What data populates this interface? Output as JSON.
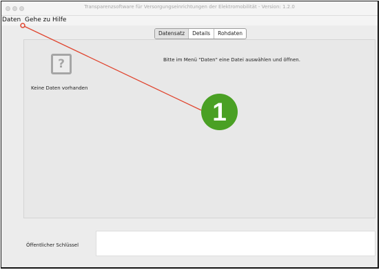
{
  "window": {
    "title": "Transparenzsoftware für Versorgungseinrichtungen der Elektromobilität - Version: 1.2.0"
  },
  "menubar": {
    "items": [
      "Daten",
      "Gehe zu",
      "Hilfe"
    ]
  },
  "tabs": {
    "items": [
      "Datensatz",
      "Details",
      "Rohdaten"
    ],
    "selected": "Datensatz"
  },
  "content": {
    "placeholder_icon_glyph": "?",
    "no_data_text": "Keine Daten vorhanden",
    "hint_text": "Bitte im Menü \"Daten\" eine Datei auswählen und öffnen."
  },
  "public_key": {
    "label": "Öffentlicher Schlüssel",
    "value": ""
  },
  "annotation": {
    "step_number": "1",
    "badge_color": "#4aa024",
    "line_color": "#e0452f"
  }
}
